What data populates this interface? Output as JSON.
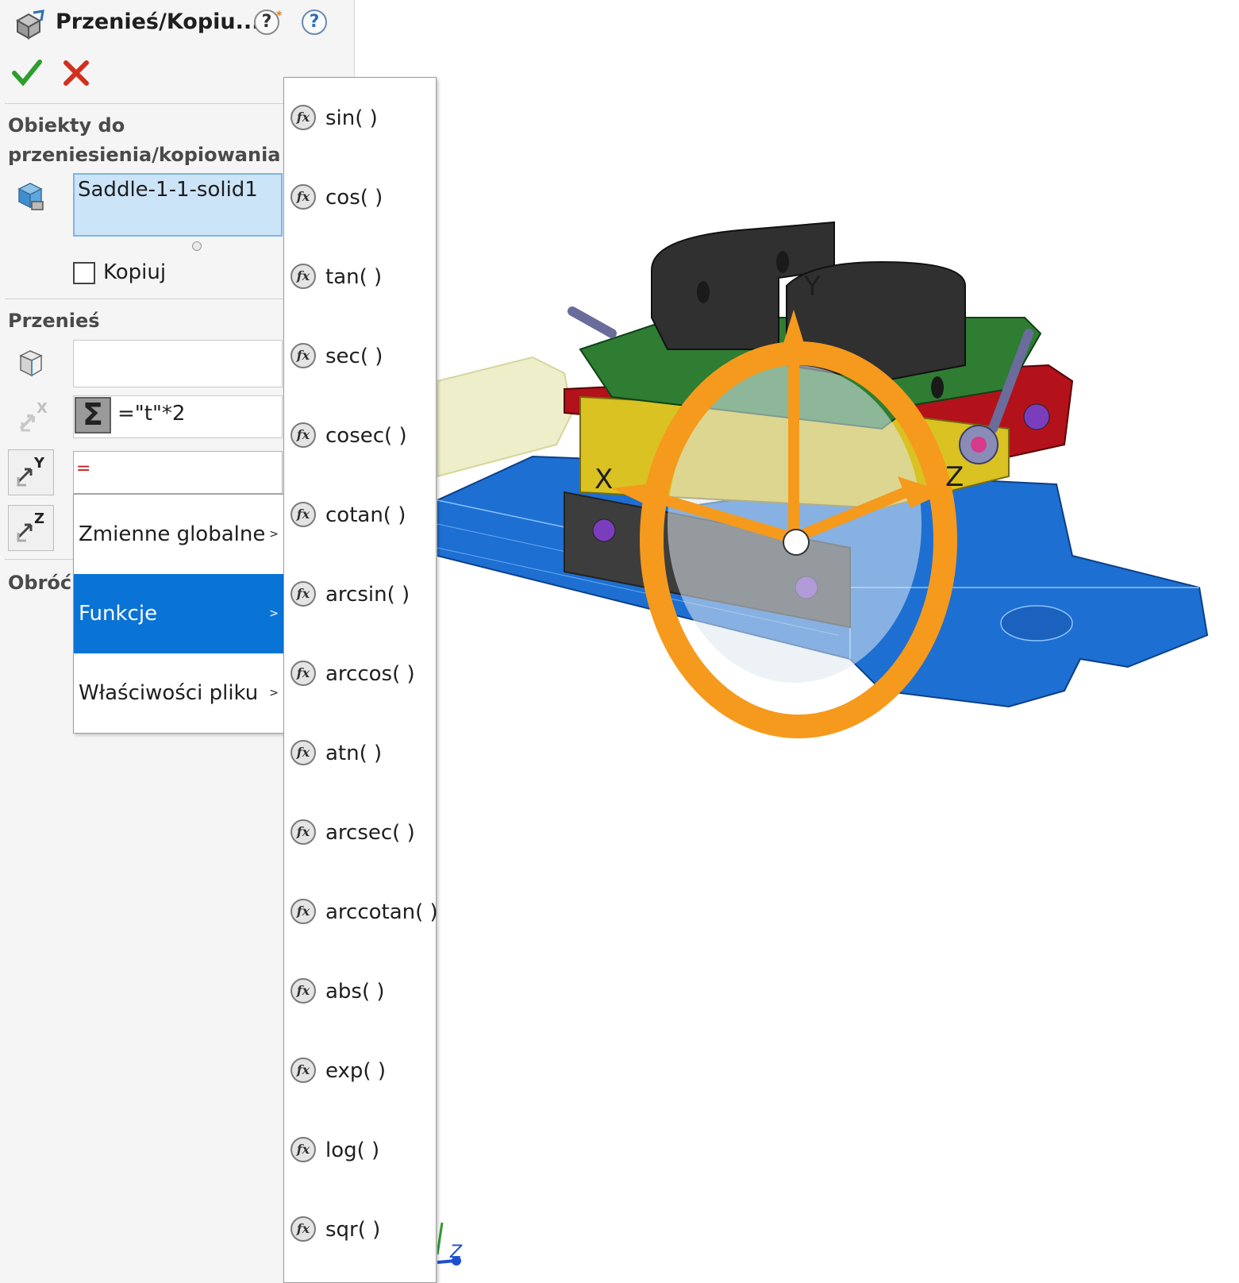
{
  "panel": {
    "title": "Przenieś/Kopiu...",
    "help_label": "?",
    "help_star": "*",
    "section_objects": "Obiekty do przeniesienia/kopiowania",
    "selected_body": "Saddle-1-1-solid1",
    "copy_label": "Kopiuj",
    "section_move": "Przenieś",
    "move_x_value": "=\"t\"*2",
    "move_y_value": "=",
    "sum_symbol": "Σ",
    "section_rotate": "Obróć"
  },
  "context_menu": {
    "items": [
      {
        "label": "Zmienne globalne",
        "arrow": ">"
      },
      {
        "label": "Funkcje",
        "arrow": ">"
      },
      {
        "label": "Właściwości pliku",
        "arrow": ">"
      }
    ],
    "active_index": 1
  },
  "functions_menu": {
    "icon_text": "fx",
    "items": [
      "sin( )",
      "cos( )",
      "tan( )",
      "sec( )",
      "cosec( )",
      "cotan( )",
      "arcsin( )",
      "arccos( )",
      "atn( )",
      "arcsec( )",
      "arccotan( )",
      "abs( )",
      "exp( )",
      "log( )",
      "sqr( )"
    ]
  },
  "viewport": {
    "triad_labels": {
      "x": "X",
      "y": "Y",
      "z": "Z"
    },
    "mini_triad_label": "Z"
  },
  "colors": {
    "accent_blue": "#0a73d6",
    "triad_orange": "#f59a1c",
    "selection_fill": "#cce4f7",
    "ok_green": "#2e9e2e",
    "cancel_red": "#d22f1e"
  }
}
